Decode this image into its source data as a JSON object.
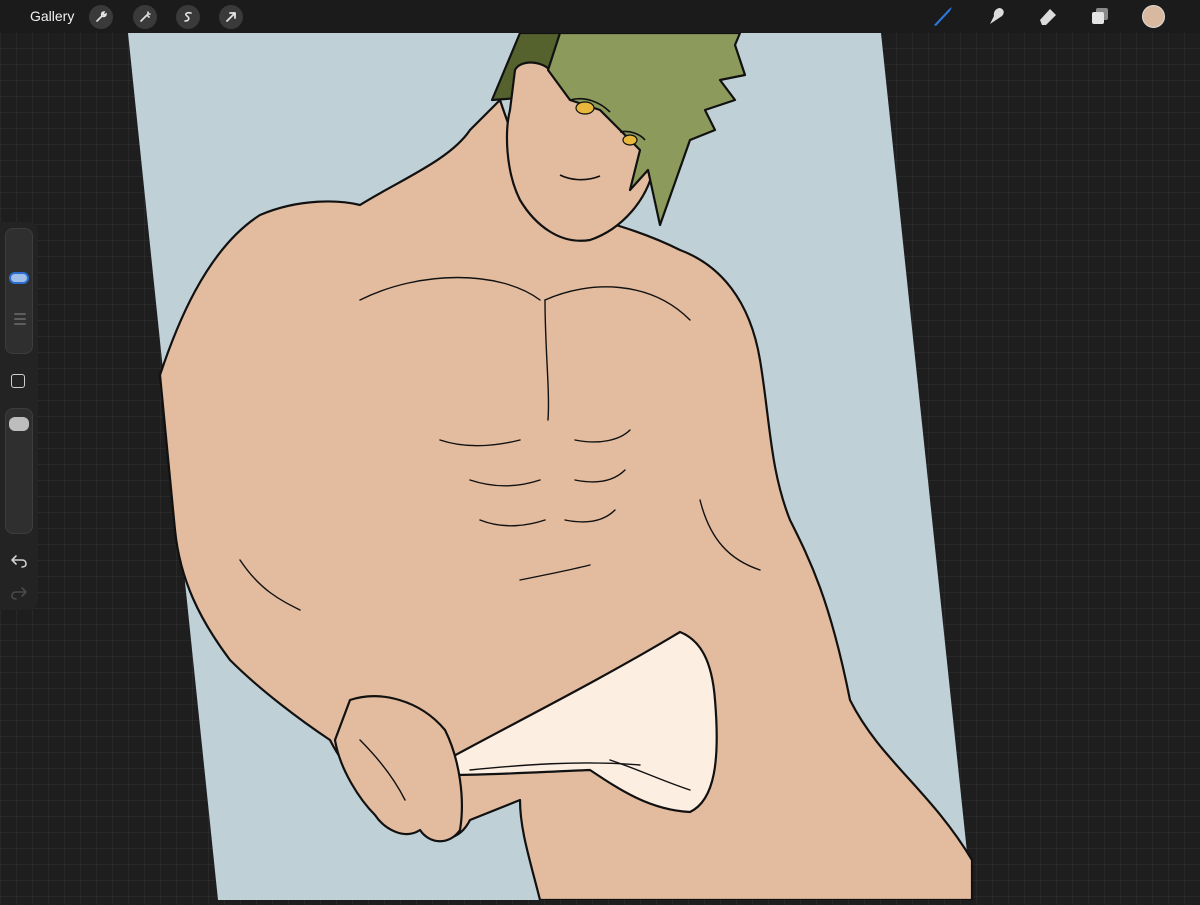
{
  "topbar": {
    "gallery_label": "Gallery",
    "left_tools": [
      "actions-wrench-icon",
      "adjustments-magic-wand-icon",
      "selection-s-icon",
      "transform-arrow-icon"
    ],
    "right_tools": [
      "brush-icon",
      "smudge-icon",
      "eraser-icon",
      "layers-icon"
    ],
    "active_tool": "brush-icon",
    "current_color": "#d8b89e"
  },
  "sidebar": {
    "brush_size_level": 0.62,
    "opacity_level": 0.95,
    "controls": [
      "brush-size-slider",
      "modify-button",
      "opacity-slider",
      "undo-icon",
      "redo-icon"
    ]
  },
  "canvas": {
    "background_color": "#bfd0d6",
    "skin_color": "#e3bc9f",
    "hair_color": "#8c9a5b",
    "hair_shadow_color": "#55622d",
    "underwear_color": "#fdeee2",
    "eye_color": "#e8b73b",
    "line_color": "#111111",
    "accent_color": "#2a78e0"
  }
}
